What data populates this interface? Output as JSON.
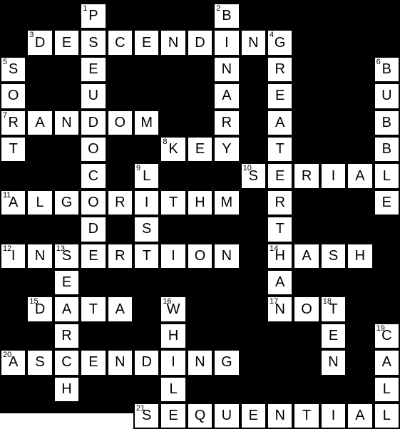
{
  "puzzle": {
    "rows": 15,
    "cols": 15,
    "colors": {
      "block": "#000000",
      "cell": "#ffffff",
      "text": "#000000"
    },
    "entries": [
      {
        "number": "1",
        "dir": "down",
        "row": 0,
        "col": 3,
        "answer": "PSEUDOCODE"
      },
      {
        "number": "2",
        "dir": "down",
        "row": 0,
        "col": 8,
        "answer": "BINARY"
      },
      {
        "number": "3",
        "dir": "across",
        "row": 1,
        "col": 1,
        "answer": "DESCENDING"
      },
      {
        "number": "4",
        "dir": "down",
        "row": 1,
        "col": 10,
        "answer": "GREATERTHAN"
      },
      {
        "number": "5",
        "dir": "down",
        "row": 2,
        "col": 0,
        "answer": "SORT"
      },
      {
        "number": "6",
        "dir": "down",
        "row": 2,
        "col": 14,
        "answer": "BUBBLE"
      },
      {
        "number": "7",
        "dir": "across",
        "row": 4,
        "col": 0,
        "answer": "RANDOM"
      },
      {
        "number": "8",
        "dir": "across",
        "row": 5,
        "col": 6,
        "answer": "KEY"
      },
      {
        "number": "9",
        "dir": "down",
        "row": 6,
        "col": 5,
        "answer": "LIST"
      },
      {
        "number": "10",
        "dir": "across",
        "row": 6,
        "col": 9,
        "answer": "SERIAL"
      },
      {
        "number": "11",
        "dir": "across",
        "row": 7,
        "col": 0,
        "answer": "ALGORITHM"
      },
      {
        "number": "12",
        "dir": "across",
        "row": 9,
        "col": 0,
        "answer": "INSERTION"
      },
      {
        "number": "13",
        "dir": "down",
        "row": 9,
        "col": 2,
        "answer": "SEARCH"
      },
      {
        "number": "14",
        "dir": "across",
        "row": 9,
        "col": 10,
        "answer": "HASH"
      },
      {
        "number": "15",
        "dir": "across",
        "row": 11,
        "col": 1,
        "answer": "DATA"
      },
      {
        "number": "16",
        "dir": "down",
        "row": 11,
        "col": 6,
        "answer": "WHILE"
      },
      {
        "number": "17",
        "dir": "across",
        "row": 11,
        "col": 10,
        "answer": "NOT"
      },
      {
        "number": "18",
        "dir": "down",
        "row": 11,
        "col": 12,
        "answer": "TEN"
      },
      {
        "number": "19",
        "dir": "down",
        "row": 12,
        "col": 14,
        "answer": "CALL"
      },
      {
        "number": "20",
        "dir": "across",
        "row": 13,
        "col": 0,
        "answer": "ASCENDING"
      },
      {
        "number": "21",
        "dir": "across",
        "row": 15,
        "col": 5,
        "answer": "SEQUENTIAL"
      }
    ]
  }
}
